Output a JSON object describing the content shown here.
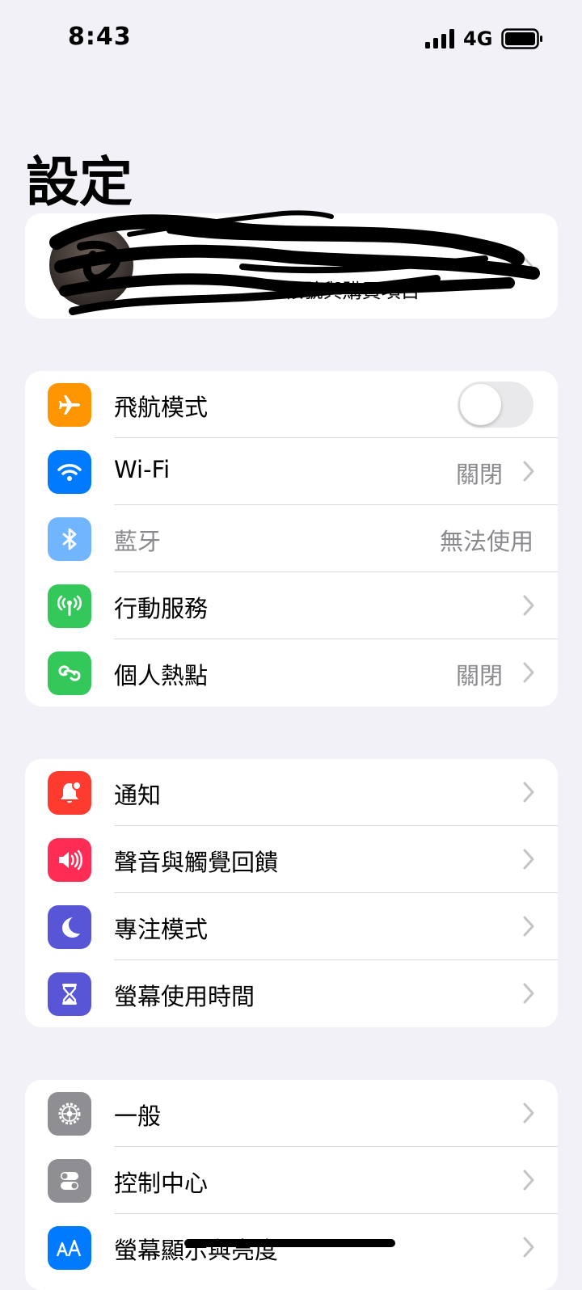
{
  "status_bar": {
    "time": "8:43",
    "network": "4G"
  },
  "page_title": "設定",
  "profile": {
    "name": "",
    "subtitle": "… 帳號與購買項目"
  },
  "groups": [
    {
      "items": [
        {
          "label": "飛航模式",
          "icon": "airplane-icon",
          "color": "#ff9500",
          "control": "toggle",
          "toggle_on": false
        },
        {
          "label": "Wi-Fi",
          "icon": "wifi-icon",
          "color": "#007aff",
          "value": "關閉",
          "chevron": true
        },
        {
          "label": "藍牙",
          "icon": "bluetooth-icon",
          "color": "#007aff",
          "value": "無法使用",
          "chevron": false,
          "disabled": true
        },
        {
          "label": "行動服務",
          "icon": "cellular-antenna-icon",
          "color": "#34c759",
          "value": "",
          "chevron": true
        },
        {
          "label": "個人熱點",
          "icon": "hotspot-chain-icon",
          "color": "#34c759",
          "value": "關閉",
          "chevron": true
        }
      ]
    },
    {
      "items": [
        {
          "label": "通知",
          "icon": "notification-bell-icon",
          "color": "#ff3b30",
          "chevron": true
        },
        {
          "label": "聲音與觸覺回饋",
          "icon": "speaker-icon",
          "color": "#ff2d55",
          "chevron": true
        },
        {
          "label": "專注模式",
          "icon": "moon-icon",
          "color": "#5856d6",
          "chevron": true
        },
        {
          "label": "螢幕使用時間",
          "icon": "hourglass-icon",
          "color": "#5856d6",
          "chevron": true
        }
      ]
    },
    {
      "items": [
        {
          "label": "一般",
          "icon": "gear-icon",
          "color": "#8e8e93",
          "chevron": true
        },
        {
          "label": "控制中心",
          "icon": "control-center-icon",
          "color": "#8e8e93",
          "chevron": true
        },
        {
          "label": "螢幕顯示與亮度",
          "icon": "text-size-aa-icon",
          "color": "#007aff",
          "chevron": true
        }
      ]
    }
  ]
}
